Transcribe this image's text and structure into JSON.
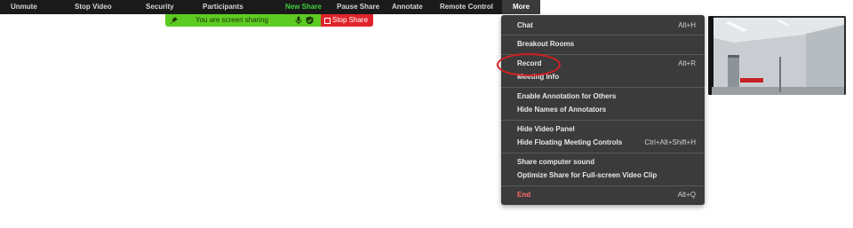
{
  "toolbar": {
    "unmute": "Unmute",
    "stop_video": "Stop Video",
    "security": "Security",
    "participants": "Participants",
    "new_share": "New Share",
    "pause_share": "Pause Share",
    "annotate": "Annotate",
    "remote_control": "Remote Control",
    "more": "More"
  },
  "share_banner": {
    "status": "You are screen sharing",
    "stop_share": "Stop Share",
    "icons": [
      "pin-icon",
      "microphone-icon",
      "shield-icon",
      "stop-square-icon"
    ]
  },
  "menu": {
    "groups": [
      [
        {
          "label": "Chat",
          "shortcut": "Alt+H"
        }
      ],
      [
        {
          "label": "Breakout Rooms",
          "shortcut": ""
        }
      ],
      [
        {
          "label": "Record",
          "shortcut": "Alt+R"
        },
        {
          "label": "Meeting Info",
          "shortcut": ""
        }
      ],
      [
        {
          "label": "Enable Annotation for Others",
          "shortcut": ""
        },
        {
          "label": "Hide Names of Annotators",
          "shortcut": ""
        }
      ],
      [
        {
          "label": "Hide Video Panel",
          "shortcut": ""
        },
        {
          "label": "Hide Floating Meeting Controls",
          "shortcut": "Ctrl+Alt+Shift+H"
        }
      ],
      [
        {
          "label": "Share computer sound",
          "shortcut": ""
        },
        {
          "label": "Optimize Share for Full-screen Video Clip",
          "shortcut": ""
        }
      ],
      [
        {
          "label": "End",
          "shortcut": "Alt+Q"
        }
      ]
    ],
    "highlighted_item": "Record"
  },
  "colors": {
    "toolbar_bg": "#1a1a1a",
    "menu_bg": "#3b3b3b",
    "share_green": "#5ecb22",
    "stop_red": "#e0232b",
    "new_share_text": "#3fd13f",
    "highlight_ring": "#d32020"
  }
}
